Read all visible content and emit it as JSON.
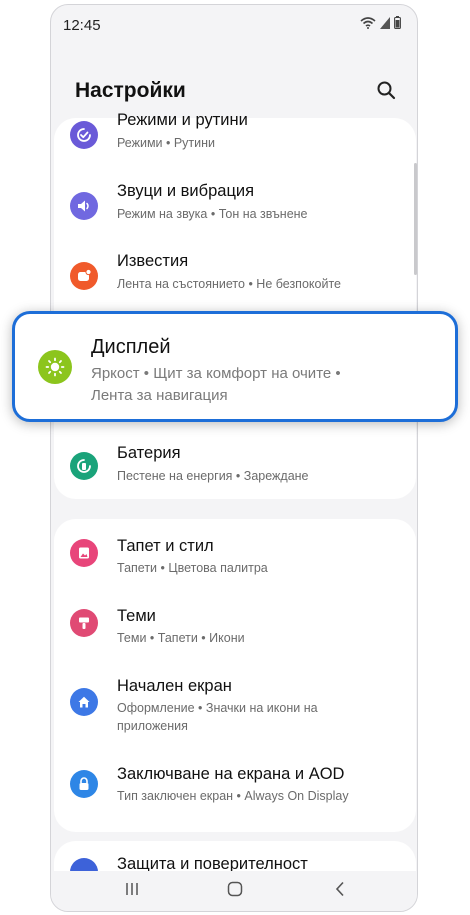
{
  "status": {
    "time": "12:45"
  },
  "header": {
    "title": "Настройки"
  },
  "colors": {
    "modes": "#6a5ad8",
    "sounds": "#7068e0",
    "notifications": "#f05a2b",
    "display": "#8cc51d",
    "battery": "#1aa37a",
    "wallpaper": "#e8457a",
    "themes": "#e04a74",
    "home": "#3d78e6",
    "lock": "#2e86e6",
    "security": "#3d62d9",
    "highlight_border": "#1d6ed8"
  },
  "settings": [
    {
      "title": "Режими и рутини",
      "subtitle": "Режими  •  Рутини",
      "icon": "modes-icon"
    },
    {
      "title": "Звуци и вибрация",
      "subtitle": "Режим на звука  •  Тон на звънене",
      "icon": "speaker-icon"
    },
    {
      "title": "Известия",
      "subtitle": "Лента на състоянието  •  Не безпокойте",
      "icon": "notification-icon"
    },
    {
      "title": "Дисплей",
      "subtitle": "Яркост  •  Щит за комфорт на очите  •",
      "subtitle2": "Лента за навигация",
      "icon": "sun-icon"
    },
    {
      "title": "Батерия",
      "subtitle": "Пестене на енергия  •  Зареждане",
      "icon": "battery-icon"
    },
    {
      "title": "Тапет и стил",
      "subtitle": "Тапети  •  Цветова палитра",
      "icon": "wallpaper-icon"
    },
    {
      "title": "Теми",
      "subtitle": "Теми  •  Тапети  •  Икони",
      "icon": "theme-brush-icon"
    },
    {
      "title": "Начален екран",
      "subtitle": "Оформление  •  Значки на икони на",
      "subtitle2": "приложения",
      "icon": "home-icon"
    },
    {
      "title": "Заключване на екрана и AOD",
      "subtitle": "Тип заключен екран  •  Always On Display",
      "icon": "lock-icon"
    },
    {
      "title": "Защита и поверителност",
      "icon": "shield-icon"
    }
  ]
}
